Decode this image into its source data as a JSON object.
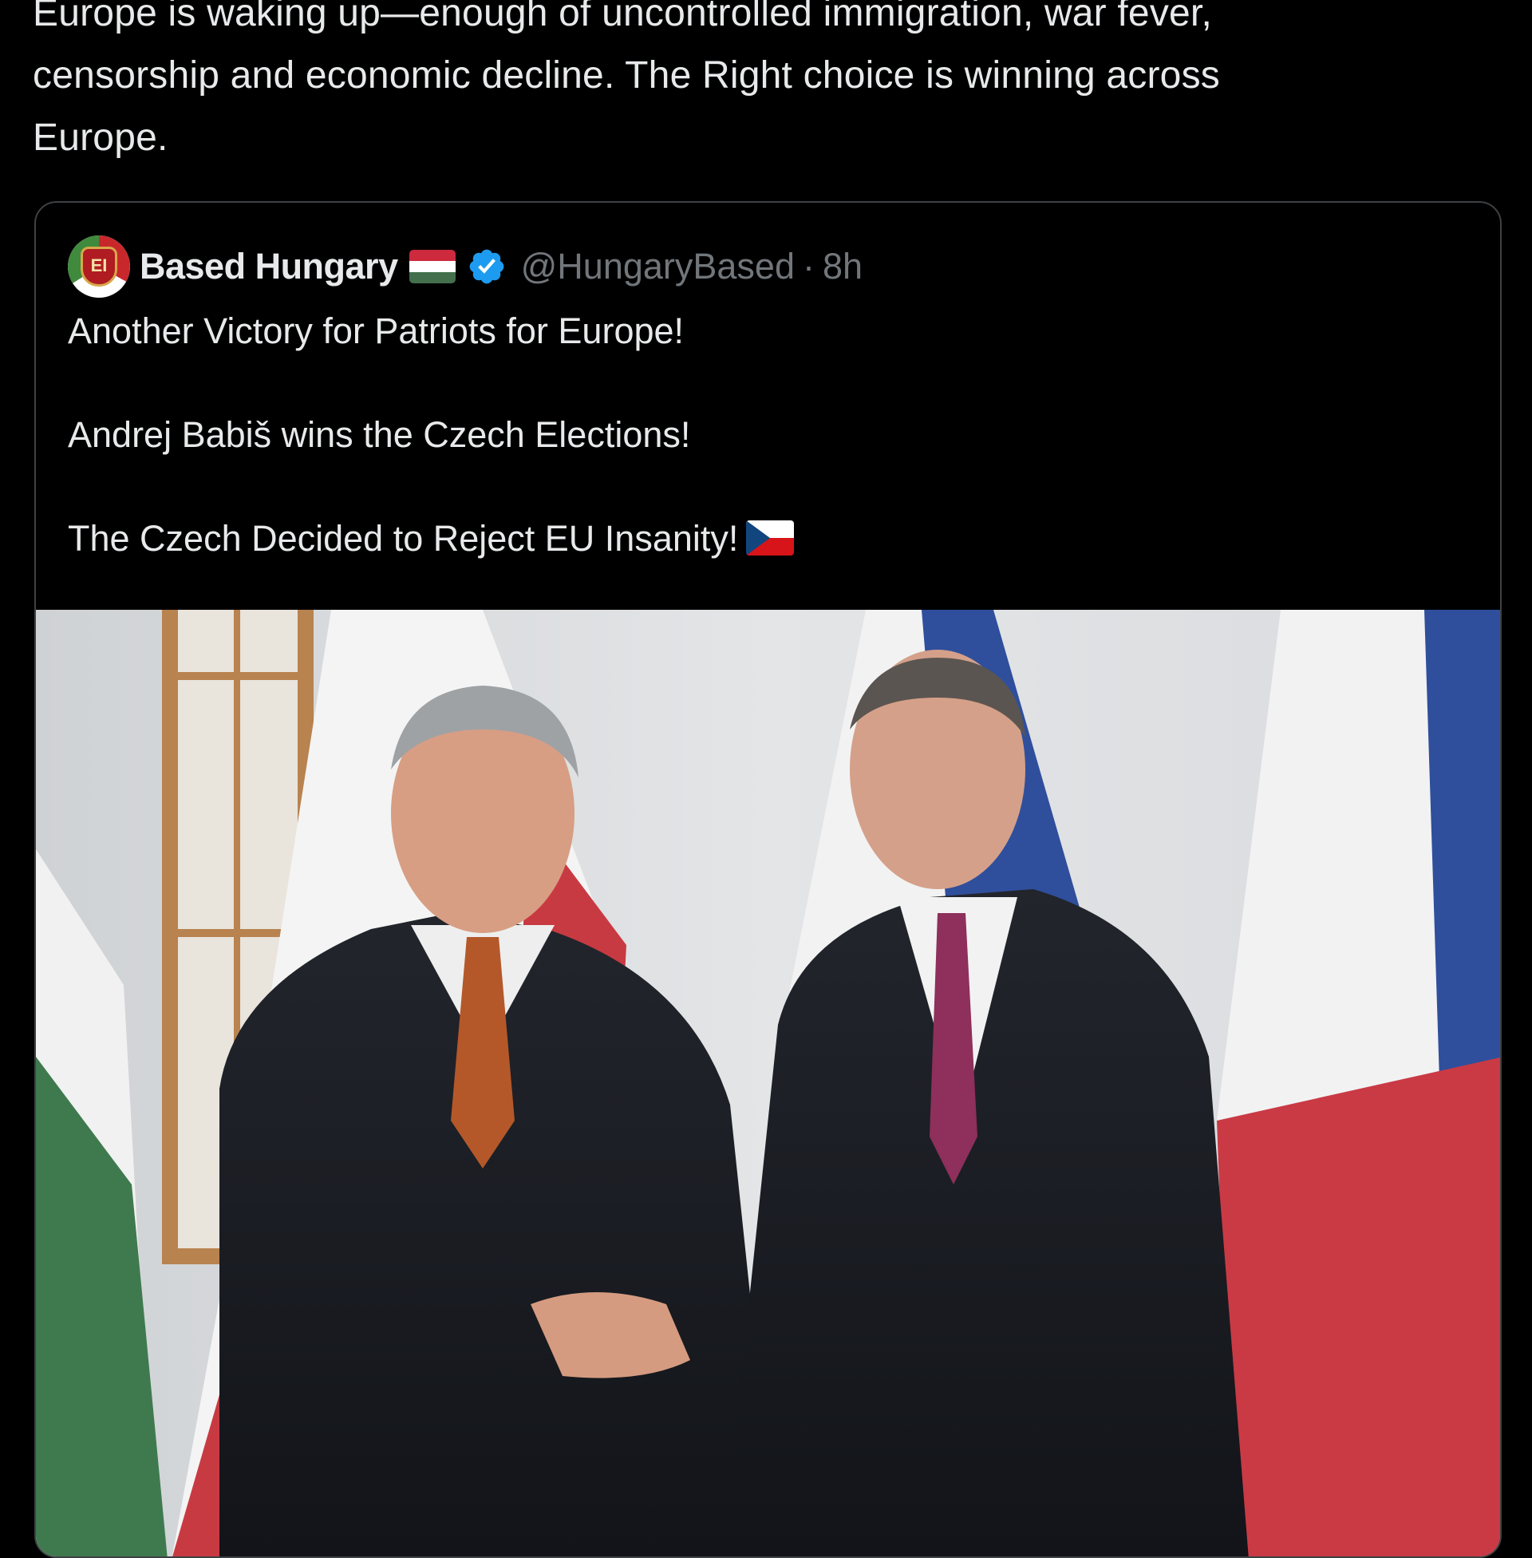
{
  "post": {
    "text": "Europe is waking up—enough of uncontrolled immigration, war fever,\ncensorship and economic decline. The Right choice is winning across\nEurope."
  },
  "quoted_post": {
    "display_name": "Based Hungary",
    "handle": "@HungaryBased",
    "separator": "·",
    "time": "8h",
    "avatar_text": "EI",
    "verified": true,
    "name_flag_icon": "hungary-flag-emoji",
    "paragraphs": [
      "Another Victory for Patriots for Europe!",
      "Andrej Babiš wins the Czech Elections!",
      "The Czech Decided to Reject EU Insanity!"
    ],
    "end_flag_icon": "czech-flag-emoji",
    "photo": {
      "description_icon": "photo-two-men-handshake-in-front-of-flags"
    }
  },
  "colors": {
    "background": "#000000",
    "text_primary": "#e7e9ea",
    "text_secondary": "#71767b",
    "card_border": "#3e4144",
    "verified_blue": "#1d9bf0",
    "hungary_red": "#cd2a3e",
    "hungary_white": "#ffffff",
    "hungary_green": "#436f4d",
    "czech_blue": "#11457e",
    "czech_red": "#d7141a"
  }
}
